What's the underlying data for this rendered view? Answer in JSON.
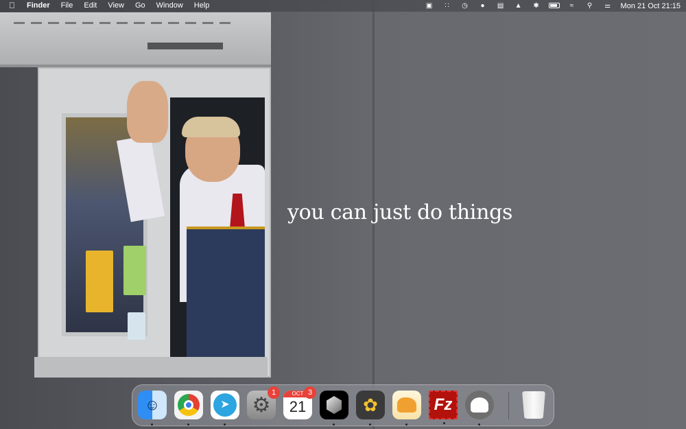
{
  "menubar": {
    "apple_icon": "apple-logo",
    "app_name": "Finder",
    "menus": [
      "File",
      "Edit",
      "View",
      "Go",
      "Window",
      "Help"
    ],
    "status_icons": [
      "drive-icon",
      "control-icon",
      "timer-icon",
      "notification-icon",
      "bed-icon",
      "airdrop-icon",
      "bluetooth-icon",
      "battery-icon",
      "wifi-icon",
      "search-icon",
      "control-center-icon"
    ],
    "clock": "Mon 21 Oct  21:15"
  },
  "wallpaper": {
    "quote": "you can just do things"
  },
  "dock": {
    "apps": [
      {
        "name": "Finder",
        "running": true
      },
      {
        "name": "Google Chrome",
        "running": true
      },
      {
        "name": "Telegram",
        "running": true
      },
      {
        "name": "System Settings",
        "running": false,
        "badge": "1"
      },
      {
        "name": "Calendar",
        "running": false,
        "badge": "3",
        "month": "OCT",
        "day": "21"
      },
      {
        "name": "Cube App",
        "running": true
      },
      {
        "name": "Ulysses",
        "running": true
      },
      {
        "name": "TablePlus",
        "running": true
      },
      {
        "name": "FileZilla",
        "running": true,
        "glyph": "Fz"
      },
      {
        "name": "MAMP",
        "running": true
      }
    ],
    "trash": "Trash"
  }
}
